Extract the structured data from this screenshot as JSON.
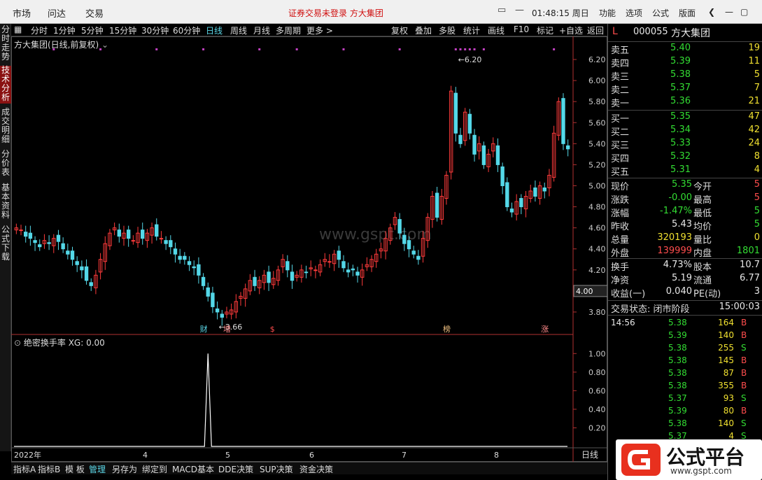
{
  "menu": {
    "items": [
      "市场",
      "问达",
      "交易"
    ],
    "notice": "证券交易未登录  方大集团",
    "clock": "01:48:15 周日",
    "right": [
      "功能",
      "选项",
      "公式",
      "版面"
    ]
  },
  "lefttabs": [
    "分时走势",
    "技术分析",
    "成交明细",
    "分价表",
    "基本资料",
    "公式下载"
  ],
  "toolbar": [
    "分时",
    "1分钟",
    "5分钟",
    "15分钟",
    "30分钟",
    "60分钟",
    "日线",
    "周线",
    "月线",
    "多周期",
    "更多 >"
  ],
  "toolbar_right": [
    "复权",
    "叠加",
    "多股",
    "统计",
    "画线",
    "F10",
    "标记",
    "+自选",
    "返回"
  ],
  "chart_label": "方大集团(日线,前复权)",
  "indicator_label": "绝密换手率  XG: 0.00",
  "watermark": "www.gspt.com",
  "cursor_price": "4.00",
  "period_label": "日线",
  "markers": {
    "high": "6.20",
    "low": "3.66",
    "events": [
      "财",
      "增",
      "$",
      "榜",
      "涨"
    ]
  },
  "bottom_tabs": [
    "指标A",
    "指标B",
    "模 板",
    "管理",
    "另存为",
    "绑定到",
    "MACD基本",
    "DDE决策",
    "SUP决策",
    "资金决策"
  ],
  "stock": {
    "flag": "L",
    "code": "000055",
    "name": "方大集团"
  },
  "asks": [
    {
      "label": "卖五",
      "price": "5.40",
      "vol": "19"
    },
    {
      "label": "卖四",
      "price": "5.39",
      "vol": "11"
    },
    {
      "label": "卖三",
      "price": "5.38",
      "vol": "5"
    },
    {
      "label": "卖二",
      "price": "5.37",
      "vol": "7"
    },
    {
      "label": "卖一",
      "price": "5.36",
      "vol": "21"
    }
  ],
  "bids": [
    {
      "label": "买一",
      "price": "5.35",
      "vol": "47"
    },
    {
      "label": "买二",
      "price": "5.34",
      "vol": "42"
    },
    {
      "label": "买三",
      "price": "5.33",
      "vol": "24"
    },
    {
      "label": "买四",
      "price": "5.32",
      "vol": "8"
    },
    {
      "label": "买五",
      "price": "5.31",
      "vol": "4"
    }
  ],
  "quote": [
    {
      "l1": "现价",
      "v1": "5.35",
      "c1": "green",
      "l2": "今开",
      "v2": "5",
      "c2": "red"
    },
    {
      "l1": "涨跌",
      "v1": "-0.00",
      "c1": "green",
      "l2": "最高",
      "v2": "5",
      "c2": "red"
    },
    {
      "l1": "涨幅",
      "v1": "-1.47%",
      "c1": "green",
      "l2": "最低",
      "v2": "5",
      "c2": "green"
    },
    {
      "l1": "昨收",
      "v1": "5.43",
      "c1": "white",
      "l2": "均价",
      "v2": "5",
      "c2": "green"
    },
    {
      "l1": "总量",
      "v1": "320193",
      "c1": "yellow",
      "l2": "量比",
      "v2": "0",
      "c2": "yellow"
    },
    {
      "l1": "外盘",
      "v1": "139999",
      "c1": "red",
      "l2": "内盘",
      "v2": "1801",
      "c2": "green"
    }
  ],
  "finance": [
    {
      "l1": "换手",
      "v1": "4.73%",
      "l2": "股本",
      "v2": "10.7"
    },
    {
      "l1": "净资",
      "v1": "5.19",
      "l2": "流通",
      "v2": "6.77"
    },
    {
      "l1": "收益(一)",
      "v1": "0.040",
      "l2": "PE(动)",
      "v2": "3"
    }
  ],
  "status": {
    "label": "交易状态: 闭市阶段",
    "time": "15:00:03"
  },
  "ticks": [
    {
      "time": "14:56",
      "price": "5.38",
      "vol": "164",
      "side": "B"
    },
    {
      "time": "",
      "price": "5.39",
      "vol": "140",
      "side": "B"
    },
    {
      "time": "",
      "price": "5.38",
      "vol": "255",
      "side": "S"
    },
    {
      "time": "",
      "price": "5.38",
      "vol": "145",
      "side": "B"
    },
    {
      "time": "",
      "price": "5.38",
      "vol": "87",
      "side": "B"
    },
    {
      "time": "",
      "price": "5.38",
      "vol": "355",
      "side": "B"
    },
    {
      "time": "",
      "price": "5.37",
      "vol": "93",
      "side": "S"
    },
    {
      "time": "",
      "price": "5.39",
      "vol": "80",
      "side": "B"
    },
    {
      "time": "",
      "price": "5.38",
      "vol": "140",
      "side": "S"
    },
    {
      "time": "",
      "price": "5.37",
      "vol": "4",
      "side": "S"
    }
  ],
  "logo": {
    "text": "公式平台",
    "url": "www.gspt.com"
  },
  "colors": {
    "up": "#ff3b3b",
    "down": "#54d8e8",
    "bg": "#000000",
    "accent": "#5bd8e8"
  },
  "chart_data": [
    {
      "type": "candlestick",
      "title": "方大集团(日线,前复权)",
      "x_ticks": [
        "2022年",
        "4",
        "5",
        "6",
        "7",
        "8"
      ],
      "ylim": [
        3.6,
        6.3
      ],
      "y_ticks": [
        3.8,
        4.0,
        4.2,
        4.4,
        4.6,
        4.8,
        5.0,
        5.2,
        5.4,
        5.6,
        5.8,
        6.0,
        6.2
      ],
      "annotations": [
        {
          "text": "6.20",
          "kind": "high"
        },
        {
          "text": "3.66",
          "kind": "low"
        }
      ],
      "closes": [
        4.6,
        4.58,
        4.52,
        4.5,
        4.46,
        4.42,
        4.48,
        4.45,
        4.5,
        4.47,
        4.4,
        4.35,
        4.3,
        4.25,
        4.2,
        4.1,
        4.05,
        4.15,
        4.3,
        4.45,
        4.55,
        4.6,
        4.52,
        4.55,
        4.5,
        4.48,
        4.55,
        4.5,
        4.55,
        4.6,
        4.52,
        4.5,
        4.45,
        4.42,
        4.35,
        4.3,
        4.3,
        4.25,
        4.22,
        4.15,
        4.05,
        3.95,
        3.85,
        3.8,
        3.75,
        3.8,
        3.82,
        3.9,
        3.95,
        4.02,
        4.1,
        4.05,
        4.1,
        4.15,
        4.08,
        4.12,
        4.2,
        4.3,
        4.2,
        4.1,
        4.15,
        4.2,
        4.18,
        4.22,
        4.2,
        4.25,
        4.3,
        4.28,
        4.35,
        4.3,
        4.22,
        4.18,
        4.2,
        4.15,
        4.2,
        4.25,
        4.3,
        4.35,
        4.4,
        4.5,
        4.6,
        4.7,
        4.55,
        4.45,
        4.4,
        4.35,
        4.3,
        4.5,
        4.7,
        4.9,
        4.7,
        4.9,
        5.1,
        5.9,
        5.5,
        5.4,
        5.7,
        5.5,
        5.3,
        5.4,
        5.2,
        5.3,
        5.4,
        5.2,
        5.0,
        4.8,
        4.75,
        4.85,
        4.8,
        4.9,
        4.95,
        4.9,
        5.0,
        4.95,
        5.1,
        5.5,
        5.8,
        5.4,
        5.35
      ],
      "candle_count": 118
    },
    {
      "type": "line",
      "title": "绝密换手率",
      "ylim": [
        0,
        1.1
      ],
      "y_ticks": [
        0.2,
        0.4,
        0.6,
        0.8,
        1.0
      ],
      "series": [
        {
          "name": "XG",
          "spike_index": 41,
          "spike_value": 1.0,
          "base": 0.0
        }
      ]
    }
  ]
}
